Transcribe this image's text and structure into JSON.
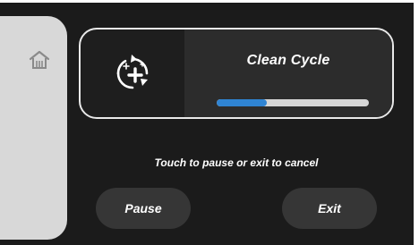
{
  "sidebar": {
    "home_icon": "home-icon"
  },
  "cycle": {
    "icon": "clean-cycle-icon",
    "title": "Clean Cycle",
    "progress_fraction": 0.33,
    "progress_color": "#2f84d3"
  },
  "instruction": "Touch to pause or exit to cancel",
  "buttons": {
    "pause_label": "Pause",
    "exit_label": "Exit"
  }
}
